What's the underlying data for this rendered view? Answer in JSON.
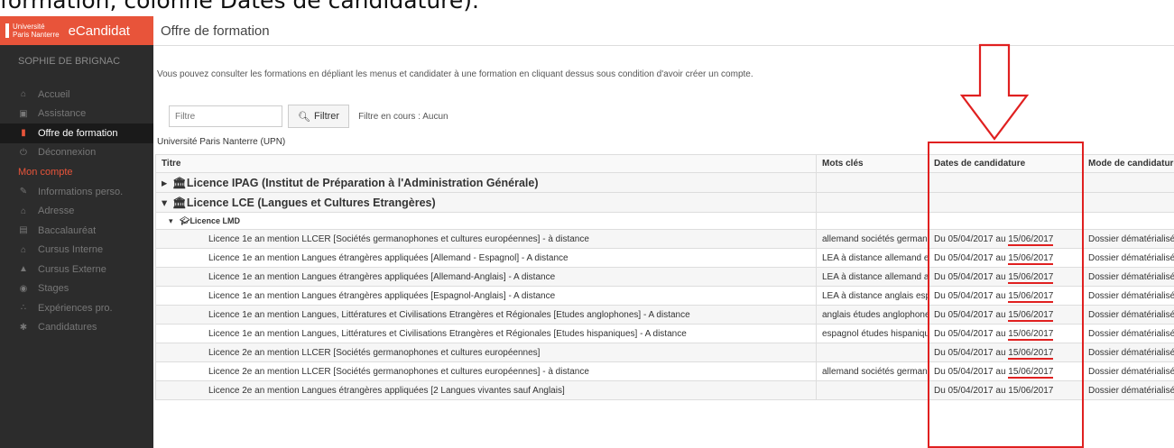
{
  "caption": "formation, colonne Dates de candidature).",
  "brand": {
    "logo_line1": "Université",
    "logo_line2": "Paris Nanterre",
    "name": "eCandidat"
  },
  "user": "SOPHIE DE BRIGNAC",
  "nav": [
    {
      "label": "Accueil",
      "icon": "home-icon",
      "glyph": "⌂"
    },
    {
      "label": "Assistance",
      "icon": "car-icon",
      "glyph": "▣"
    },
    {
      "label": "Offre de formation",
      "icon": "bookmark-icon",
      "glyph": "▮"
    },
    {
      "label": "Déconnexion",
      "icon": "power-icon",
      "glyph": "⏻"
    }
  ],
  "account_section": "Mon compte",
  "account_nav": [
    {
      "label": "Informations perso.",
      "icon": "pencil-icon",
      "glyph": "✎"
    },
    {
      "label": "Adresse",
      "icon": "home-icon",
      "glyph": "⌂"
    },
    {
      "label": "Baccalauréat",
      "icon": "book-icon",
      "glyph": "▤"
    },
    {
      "label": "Cursus Interne",
      "icon": "bank-icon",
      "glyph": "⌂"
    },
    {
      "label": "Cursus Externe",
      "icon": "graduation-cap-icon",
      "glyph": "▲"
    },
    {
      "label": "Stages",
      "icon": "stage-icon",
      "glyph": "◉"
    },
    {
      "label": "Expériences pro.",
      "icon": "share-icon",
      "glyph": "∴"
    },
    {
      "label": "Candidatures",
      "icon": "asterisk-icon",
      "glyph": "✱"
    }
  ],
  "page": {
    "title": "Offre de formation",
    "intro": "Vous pouvez consulter les formations en dépliant les menus et candidater à une formation en cliquant dessus sous condition d'avoir créer un compte.",
    "filter_placeholder": "Filtre",
    "filter_button": "Filtrer",
    "filter_status": "Filtre en cours : Aucun",
    "org": "Université Paris Nanterre (UPN)"
  },
  "table": {
    "headers": [
      "Titre",
      "Mots clés",
      "Dates de candidature",
      "Mode de candidature"
    ],
    "group1": "Licence IPAG (Institut de Préparation à l'Administration Générale)",
    "group2": "Licence LCE (Langues et Cultures Etrangères)",
    "subgroup": "Licence LMD",
    "rows": [
      {
        "title": "Licence 1e an mention LLCER [Sociétés germanophones et cultures européennes] - à distance",
        "keywords": "allemand sociétés germanophones",
        "dates_prefix": "Du 05/04/2017 au",
        "dates_end": "15/06/2017",
        "mode": "Dossier dématérialisé"
      },
      {
        "title": "Licence 1e an mention Langues étrangères appliquées [Allemand - Espagnol] - A distance",
        "keywords": "LEA à distance allemand espagnol",
        "dates_prefix": "Du 05/04/2017 au",
        "dates_end": "15/06/2017",
        "mode": "Dossier dématérialisé"
      },
      {
        "title": "Licence 1e an mention Langues étrangères appliquées [Allemand-Anglais] - A distance",
        "keywords": "LEA à distance allemand anglais",
        "dates_prefix": "Du 05/04/2017 au",
        "dates_end": "15/06/2017",
        "mode": "Dossier dématérialisé"
      },
      {
        "title": "Licence 1e an mention Langues étrangères appliquées [Espagnol-Anglais] - A distance",
        "keywords": "LEA à distance anglais espagnol",
        "dates_prefix": "Du 05/04/2017 au",
        "dates_end": "15/06/2017",
        "mode": "Dossier dématérialisé"
      },
      {
        "title": "Licence 1e an mention Langues, Littératures et Civilisations Etrangères et Régionales [Etudes anglophones] - A distance",
        "keywords": "anglais études anglophones",
        "dates_prefix": "Du 05/04/2017 au",
        "dates_end": "15/06/2017",
        "mode": "Dossier dématérialisé"
      },
      {
        "title": "Licence 1e an mention Langues, Littératures et Civilisations Etrangères et Régionales [Etudes hispaniques] - A distance",
        "keywords": "espagnol études hispaniques",
        "dates_prefix": "Du 05/04/2017 au",
        "dates_end": "15/06/2017",
        "mode": "Dossier dématérialisé"
      },
      {
        "title": "Licence 2e an mention LLCER [Sociétés germanophones et cultures européennes]",
        "keywords": "",
        "dates_prefix": "Du 05/04/2017 au",
        "dates_end": "15/06/2017",
        "mode": "Dossier dématérialisé"
      },
      {
        "title": "Licence 2e an mention LLCER [Sociétés germanophones et cultures européennes] - à distance",
        "keywords": "allemand sociétés germanophones",
        "dates_prefix": "Du 05/04/2017 au",
        "dates_end": "15/06/2017",
        "mode": "Dossier dématérialisé"
      },
      {
        "title": "Licence 2e an mention Langues étrangères appliquées [2 Langues vivantes sauf Anglais]",
        "keywords": "",
        "dates_prefix": "Du 05/04/2017 au",
        "dates_end": "15/06/2017",
        "mode": "Dossier dématérialisé"
      }
    ]
  },
  "colors": {
    "brand": "#e8543a",
    "sidebar": "#2c2c2c",
    "annotation": "#e02020"
  }
}
